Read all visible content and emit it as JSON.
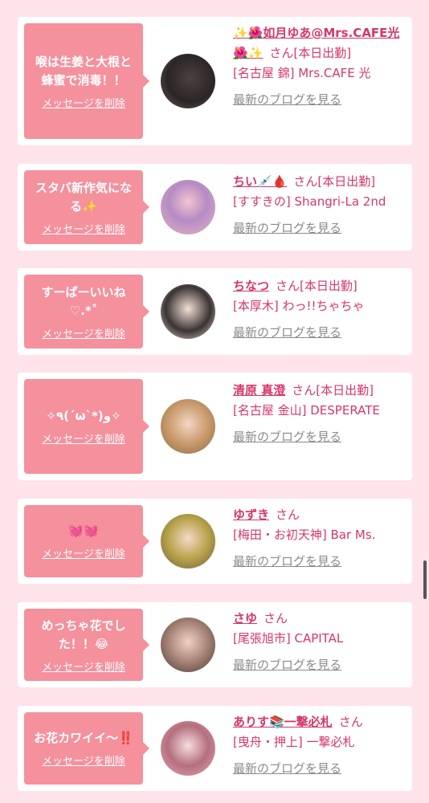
{
  "messages": [
    {
      "bubble": "喉は生姜と大根と蜂蜜で消毒！！",
      "name": "✨🌺如月ゆあ@Mrs.CAFE光🌺✨",
      "san": "さん",
      "status": "[本日出勤]",
      "shop": "[名古屋 錦] Mrs.CAFE 光",
      "delete": "メッセージを削除",
      "blog": "最新のブログを見る"
    },
    {
      "bubble": "スタバ新作気になる✨",
      "name": "ちい💉🩸",
      "san": "さん",
      "status": "[本日出勤]",
      "shop": "[すすきの] Shangri-La 2nd",
      "delete": "メッセージを削除",
      "blog": "最新のブログを見る"
    },
    {
      "bubble": "すーぱーいいね♡.*˚",
      "name": "ちなつ",
      "san": "さん",
      "status": "[本日出勤]",
      "shop": "[本厚木] わっ!!ちゃちゃ",
      "delete": "メッセージを削除",
      "blog": "最新のブログを見る"
    },
    {
      "bubble": "✧٩(ˊωˋ*)و✧",
      "name": "清原 真澄",
      "san": "さん",
      "status": "[本日出勤]",
      "shop": "[名古屋 金山] DESPERATE",
      "delete": "メッセージを削除",
      "blog": "最新のブログを見る"
    },
    {
      "bubble": "💓💓",
      "name": "ゆずき",
      "san": "さん",
      "status": "",
      "shop": "[梅田・お初天神] Bar Ms.",
      "delete": "メッセージを削除",
      "blog": "最新のブログを見る"
    },
    {
      "bubble": "めっちゃ花でした！！😂",
      "name": "さゆ",
      "san": "さん",
      "status": "",
      "shop": "[尾張旭市] CAPITAL",
      "delete": "メッセージを削除",
      "blog": "最新のブログを見る"
    },
    {
      "bubble": "お花カワイイ〜‼️",
      "name": "ありす📚一撃必札",
      "san": "さん",
      "status": "",
      "shop": "[曳舟・押上] 一撃必札",
      "delete": "メッセージを削除",
      "blog": "最新のブログを見る"
    }
  ],
  "colors": {
    "background": "#ffe3ea",
    "bubble": "#f5909d",
    "accent": "#d6366a",
    "link_gray": "#8a8a8a"
  }
}
